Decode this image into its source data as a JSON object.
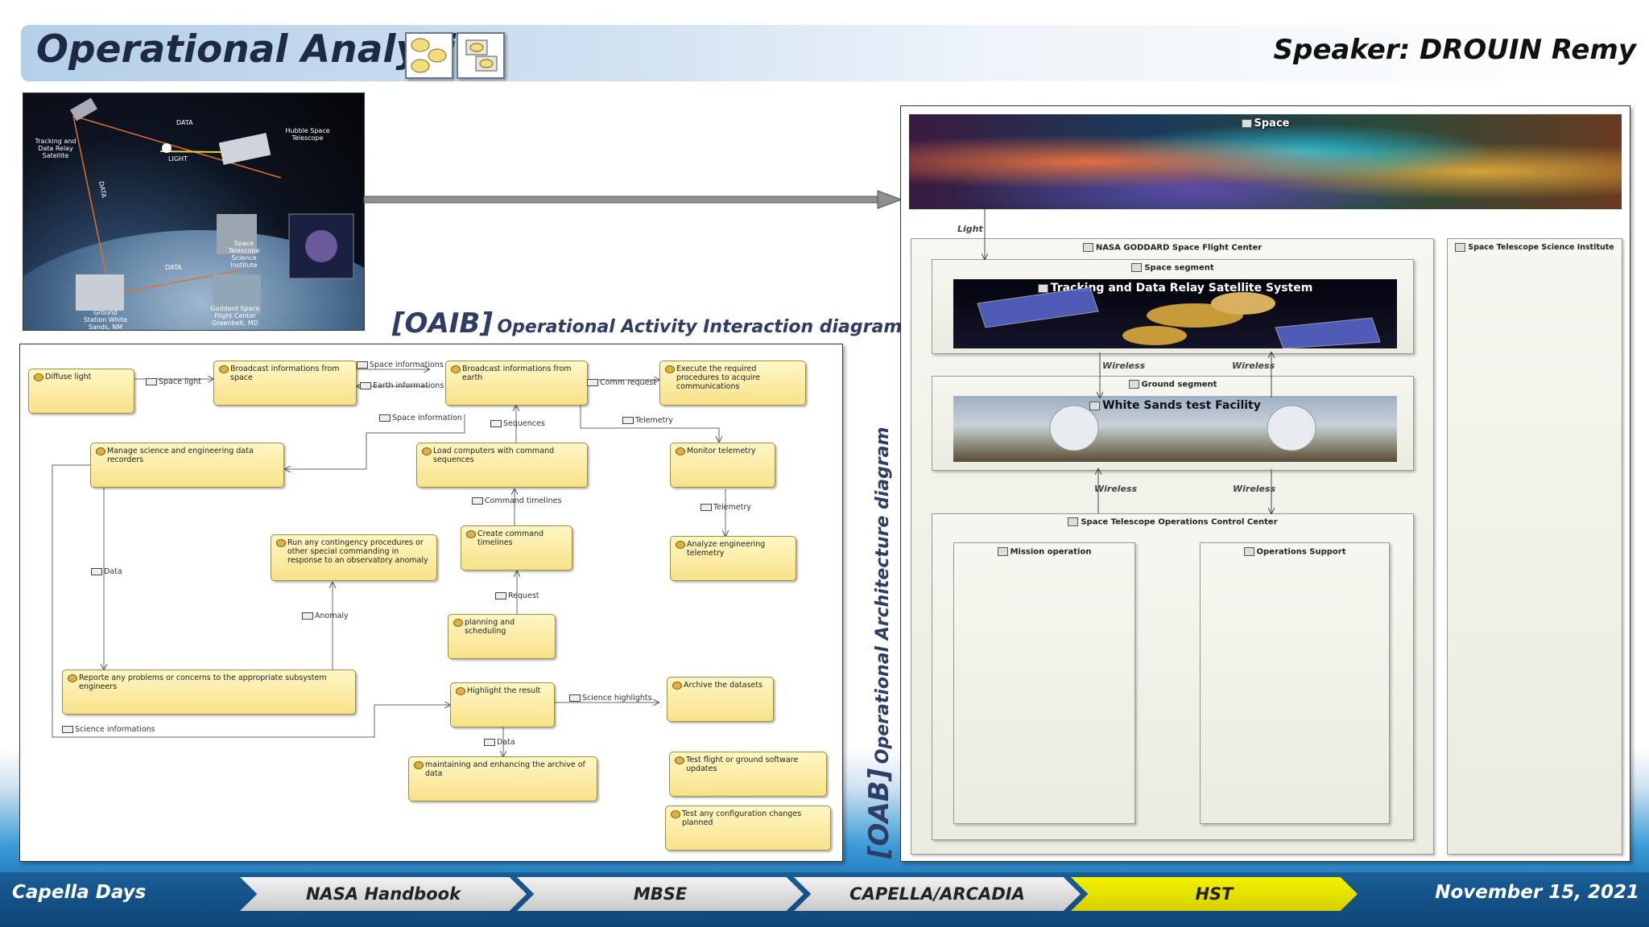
{
  "header": {
    "title": "Operational Analysis",
    "speaker": "Speaker: DROUIN Remy"
  },
  "photo": {
    "labels": {
      "tdrs": "Tracking and Data Relay Satellite",
      "hubble": "Hubble Space Telescope",
      "data1": "DATA",
      "data2": "DATA",
      "data3": "DATA",
      "light": "LIGHT",
      "stsci": "Space Telescope Science Institute",
      "ground": "Ground Station White Sands, NM",
      "goddard": "Goddard Space Flight Center Greenbelt, MD"
    }
  },
  "oaib": {
    "title_code": "[OAIB]",
    "title_text": "Operational Activity Interaction diagram",
    "activities": {
      "diffuse": "Diffuse light",
      "broadcast_space": "Broadcast informations from space",
      "broadcast_earth": "Broadcast informations from earth",
      "execute": "Execute the required procedures to acquire communications",
      "manage": "Manage science and engineering data recorders",
      "load": "Load computers with command sequences",
      "monitor": "Monitor telemetry",
      "contingency": "Run any contingency procedures or other special commanding in response to an observatory anomaly",
      "create": "Create command timelines",
      "analyze": "Analyze engineering telemetry",
      "planning": "planning and scheduling",
      "report": "Reporte any problems or concerns to the appropriate subsystem engineers",
      "highlight": "Highlight the result",
      "archive": "Archive the datasets",
      "test_flight": "Test flight or ground software updates",
      "maintain": "maintaining and enhancing the archive of data",
      "test_config": "Test any configuration changes planned"
    },
    "edges": {
      "space_light": "Space light",
      "space_info": "Space informations",
      "earth_info": "Earth informations",
      "comm_request": "Comm request",
      "space_information": "Space information",
      "sequences": "Sequences",
      "telemetry1": "Telemetry",
      "command_timelines": "Command timelines",
      "telemetry2": "Telemetry",
      "data1": "Data",
      "anomaly": "Anomaly",
      "request": "Request",
      "science_highlights": "Science highlights",
      "science_informations": "Science informations",
      "data2": "Data"
    }
  },
  "oab": {
    "title_code": "[OAB]",
    "title_text": "Operational Architecture diagram",
    "space": "Space",
    "light": "Light",
    "nasa": "NASA GODDARD Space Flight Center",
    "space_segment": "Space segment",
    "tdrss": "Tracking and Data Relay Satellite System",
    "ground_segment": "Ground segment",
    "white_sands": "White Sands test Facility",
    "stocc": "Space Telescope Operations Control Center",
    "mission": "Mission operation",
    "ops_support": "Operations Support",
    "stsci": "Space Telescope Science Institute",
    "wireless": [
      "Wireless",
      "Wireless",
      "Wireless",
      "Wireless"
    ]
  },
  "footer": {
    "left": "Capella Days",
    "right": "November 15, 2021",
    "steps": [
      "NASA Handbook",
      "MBSE",
      "CAPELLA/ARCADIA",
      "HST"
    ],
    "active_color": "#e6e600"
  }
}
